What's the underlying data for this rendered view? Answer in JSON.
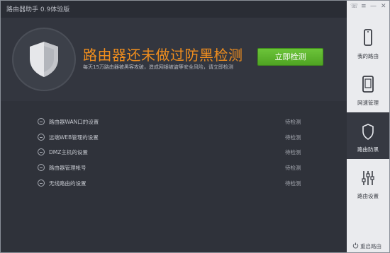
{
  "app": {
    "title": "路由器助手 0.9体验版"
  },
  "hero": {
    "title": "路由器还未做过防黑检测",
    "subtitle": "每天15万路由器被黑客攻破，造成网银被盗等安全风险，请立即检测",
    "button_label": "立即检测",
    "title_color": "#f08e1e",
    "button_color": "#5bb52d"
  },
  "check_items": [
    {
      "label": "路由器WAN口的设置",
      "status": "待检测"
    },
    {
      "label": "远端WEB管理的设置",
      "status": "待检测"
    },
    {
      "label": "DMZ主机的设置",
      "status": "待检测"
    },
    {
      "label": "路由器管理帐号",
      "status": "待检测"
    },
    {
      "label": "无线路由的设置",
      "status": "待检测"
    }
  ],
  "window_controls": {
    "feedback": "☏",
    "menu": "≡",
    "minimize": "—",
    "close": "✕"
  },
  "sidebar": {
    "items": [
      {
        "label": "我的路由",
        "icon": "phone-icon"
      },
      {
        "label": "网速管理",
        "icon": "tablet-icon"
      },
      {
        "label": "路由防黑",
        "icon": "shield-icon",
        "active": true
      },
      {
        "label": "路由设置",
        "icon": "sliders-icon"
      }
    ],
    "restart_label": "重启路由"
  }
}
